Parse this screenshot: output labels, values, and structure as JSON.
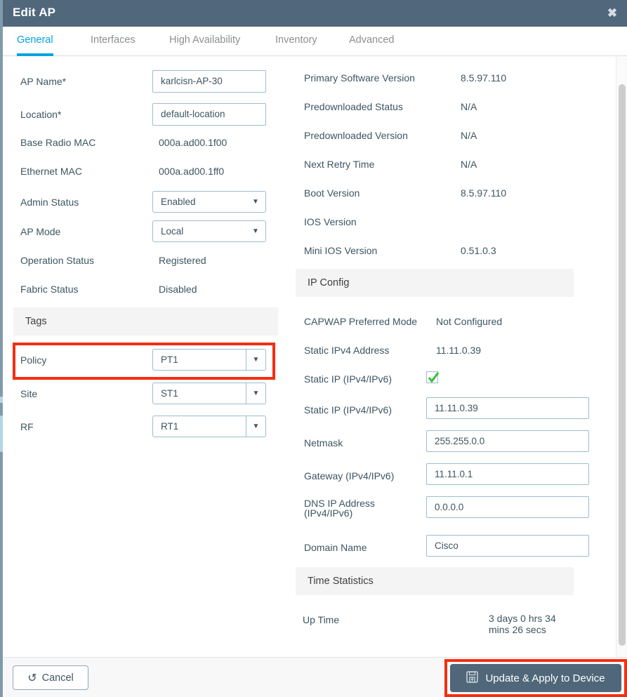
{
  "window": {
    "title": "Edit AP",
    "close_label": "✖",
    "header_color": "#51687c",
    "accent_color": "#00a3e0",
    "highlight_color": "#f42e10"
  },
  "tabs": [
    {
      "label": "General",
      "active": true
    },
    {
      "label": "Interfaces",
      "active": false
    },
    {
      "label": "High Availability",
      "active": false
    },
    {
      "label": "Inventory",
      "active": false
    },
    {
      "label": "Advanced",
      "active": false
    }
  ],
  "general": {
    "ap_name": {
      "label": "AP Name*",
      "value": "karlcisn-AP-30"
    },
    "location": {
      "label": "Location*",
      "value": "default-location"
    },
    "base_radio_mac": {
      "label": "Base Radio MAC",
      "value": "000a.ad00.1f00"
    },
    "ethernet_mac": {
      "label": "Ethernet MAC",
      "value": "000a.ad00.1ff0"
    },
    "admin_status": {
      "label": "Admin Status",
      "value": "Enabled"
    },
    "ap_mode": {
      "label": "AP Mode",
      "value": "Local"
    },
    "operation_status": {
      "label": "Operation Status",
      "value": "Registered"
    },
    "fabric_status": {
      "label": "Fabric Status",
      "value": "Disabled"
    }
  },
  "tags": {
    "section_title": "Tags",
    "policy": {
      "label": "Policy",
      "value": "PT1"
    },
    "site": {
      "label": "Site",
      "value": "ST1"
    },
    "rf": {
      "label": "RF",
      "value": "RT1"
    }
  },
  "version_info": {
    "primary_software_version": {
      "label": "Primary Software Version",
      "value": "8.5.97.110"
    },
    "predownloaded_status": {
      "label": "Predownloaded Status",
      "value": "N/A"
    },
    "predownloaded_version": {
      "label": "Predownloaded Version",
      "value": "N/A"
    },
    "next_retry_time": {
      "label": "Next Retry Time",
      "value": "N/A"
    },
    "boot_version": {
      "label": "Boot Version",
      "value": "8.5.97.110"
    },
    "ios_version": {
      "label": "IOS Version",
      "value": ""
    },
    "mini_ios_version": {
      "label": "Mini IOS Version",
      "value": "0.51.0.3"
    }
  },
  "ip_config": {
    "section_title": "IP Config",
    "capwap_preferred_mode": {
      "label": "CAPWAP Preferred Mode",
      "value": "Not Configured"
    },
    "static_ipv4_address": {
      "label": "Static IPv4 Address",
      "value": "11.11.0.39"
    },
    "static_ip_checkbox": {
      "label": "Static IP (IPv4/IPv6)",
      "checked": true
    },
    "static_ip": {
      "label": "Static IP (IPv4/IPv6)",
      "value": "11.11.0.39"
    },
    "netmask": {
      "label": "Netmask",
      "value": "255.255.0.0"
    },
    "gateway": {
      "label": "Gateway (IPv4/IPv6)",
      "value": "11.11.0.1"
    },
    "dns_ip_address": {
      "label_line1": "DNS IP Address",
      "label_line2": "(IPv4/IPv6)",
      "value": "0.0.0.0"
    },
    "domain_name": {
      "label": "Domain Name",
      "value": "Cisco"
    }
  },
  "time_statistics": {
    "section_title": "Time Statistics",
    "up_time": {
      "label": "Up Time",
      "value_line1": "3 days 0 hrs 34",
      "value_line2": "mins 26 secs"
    }
  },
  "footer": {
    "cancel_label": "Cancel",
    "cancel_icon": "↺",
    "update_label": "Update & Apply to Device",
    "update_icon": "save-icon"
  }
}
